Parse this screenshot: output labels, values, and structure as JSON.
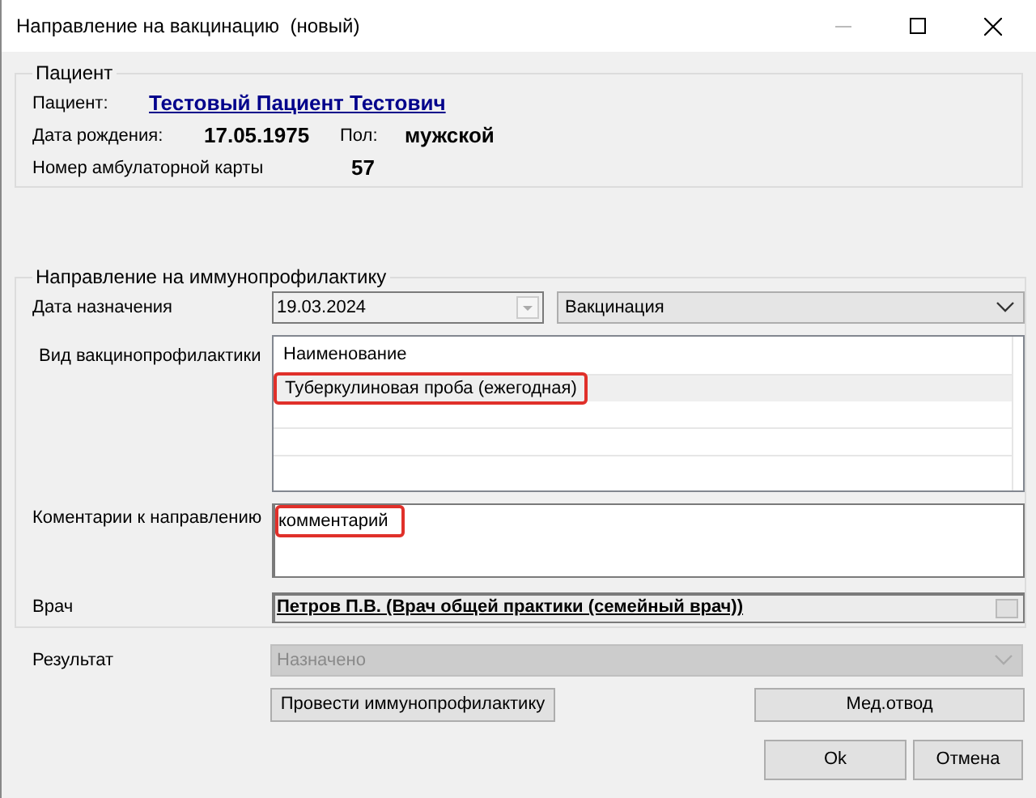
{
  "window": {
    "title": "Направление на вакцинацию  (новый)"
  },
  "patient": {
    "legend": "Пациент",
    "name_label": "Пациент:",
    "name": "Тестовый Пациент Тестович",
    "birth_label": "Дата рождения:",
    "birth_date": "17.05.1975",
    "sex_label": "Пол:",
    "sex": "мужской",
    "card_label": "Номер амбулаторной карты",
    "card_number": "57"
  },
  "referral": {
    "legend": "Направление на иммунопрофилактику",
    "date_label": "Дата назначения",
    "date": "19.03.2024",
    "type": "Вакцинация",
    "kind_label": "Вид вакцинопрофилактики",
    "table": {
      "columns": [
        "Наименование"
      ],
      "rows": [
        {
          "name": "Туберкулиновая проба (ежегодная)",
          "selected": true,
          "highlighted": true
        }
      ]
    },
    "comment_label": "Коментарии к направлению",
    "comment": "комментарий",
    "comment_highlighted": true,
    "doctor_label": "Врач",
    "doctor": "Петров П.В. (Врач общей практики (семейный врач))"
  },
  "result": {
    "label": "Результат",
    "value": "Назначено",
    "disabled": true
  },
  "buttons": [
    "Провести иммунопрофилактику",
    "Мед.отвод",
    "Ok",
    "Отмена"
  ]
}
